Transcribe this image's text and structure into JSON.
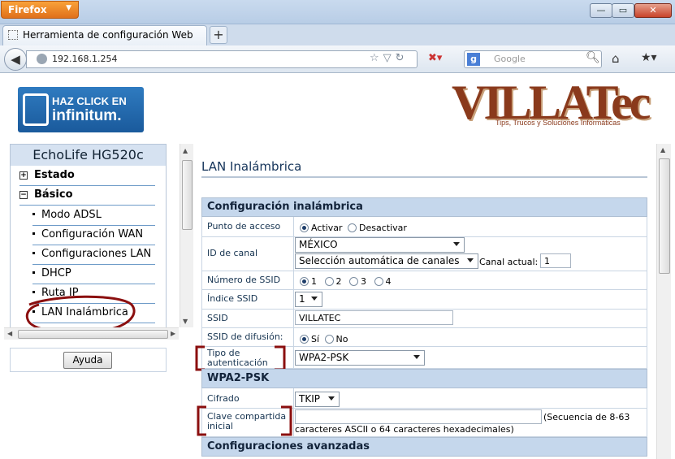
{
  "browser": {
    "app_button": "Firefox",
    "tab_title": "Herramienta de configuración Web",
    "new_tab": "+",
    "url": "192.168.1.254",
    "search_placeholder": "Google",
    "search_engine_icon": "g-icon"
  },
  "header": {
    "promo_line1": "HAZ CLICK EN",
    "promo_line2": "infinitum.",
    "brand": "VILLATec",
    "brand_tagline": "Tips, Trucos y Soluciones Informáticas"
  },
  "sidebar": {
    "device": "EchoLife HG520c",
    "top_items": [
      {
        "label": "Estado",
        "expander": "+"
      },
      {
        "label": "Básico",
        "expander": "−"
      }
    ],
    "sub_items": [
      "Modo ADSL",
      "Configuración WAN",
      "Configuraciones LAN",
      "DHCP",
      "Ruta IP",
      "LAN Inalámbrica"
    ],
    "help_button": "Ayuda"
  },
  "main": {
    "title": "LAN Inalámbrica",
    "section_wireless": "Configuración inalámbrica",
    "access_point": {
      "label": "Punto de acceso",
      "options": [
        "Activar",
        "Desactivar"
      ],
      "selected": "Activar"
    },
    "channel": {
      "label": "ID de canal",
      "country": "MÉXICO",
      "mode": "Selección automática de canales",
      "current_label": "Canal actual:",
      "current_value": "1"
    },
    "ssid_count": {
      "label": "Número de SSID",
      "options": [
        "1",
        "2",
        "3",
        "4"
      ],
      "selected": "1"
    },
    "ssid_index": {
      "label": "Índice SSID",
      "value": "1"
    },
    "ssid": {
      "label": "SSID",
      "value": "VILLATEC"
    },
    "broadcast": {
      "label": "SSID de difusión:",
      "options": [
        "Sí",
        "No"
      ],
      "selected": "Sí"
    },
    "auth": {
      "label": "Tipo de autenticación",
      "value": "WPA2-PSK"
    },
    "section_psk": "WPA2-PSK",
    "cipher": {
      "label": "Cifrado",
      "value": "TKIP"
    },
    "psk": {
      "label": "Clave compartida inicial",
      "value": "",
      "hint_line1": "(Secuencia de 8-63",
      "hint_line2": "caracteres ASCII o 64 caracteres hexadecimales)"
    },
    "section_advanced": "Configuraciones avanzadas"
  },
  "colors": {
    "accent": "#c5d7ec",
    "annotation": "#8b0f0f",
    "brand": "#8a3a1c"
  }
}
